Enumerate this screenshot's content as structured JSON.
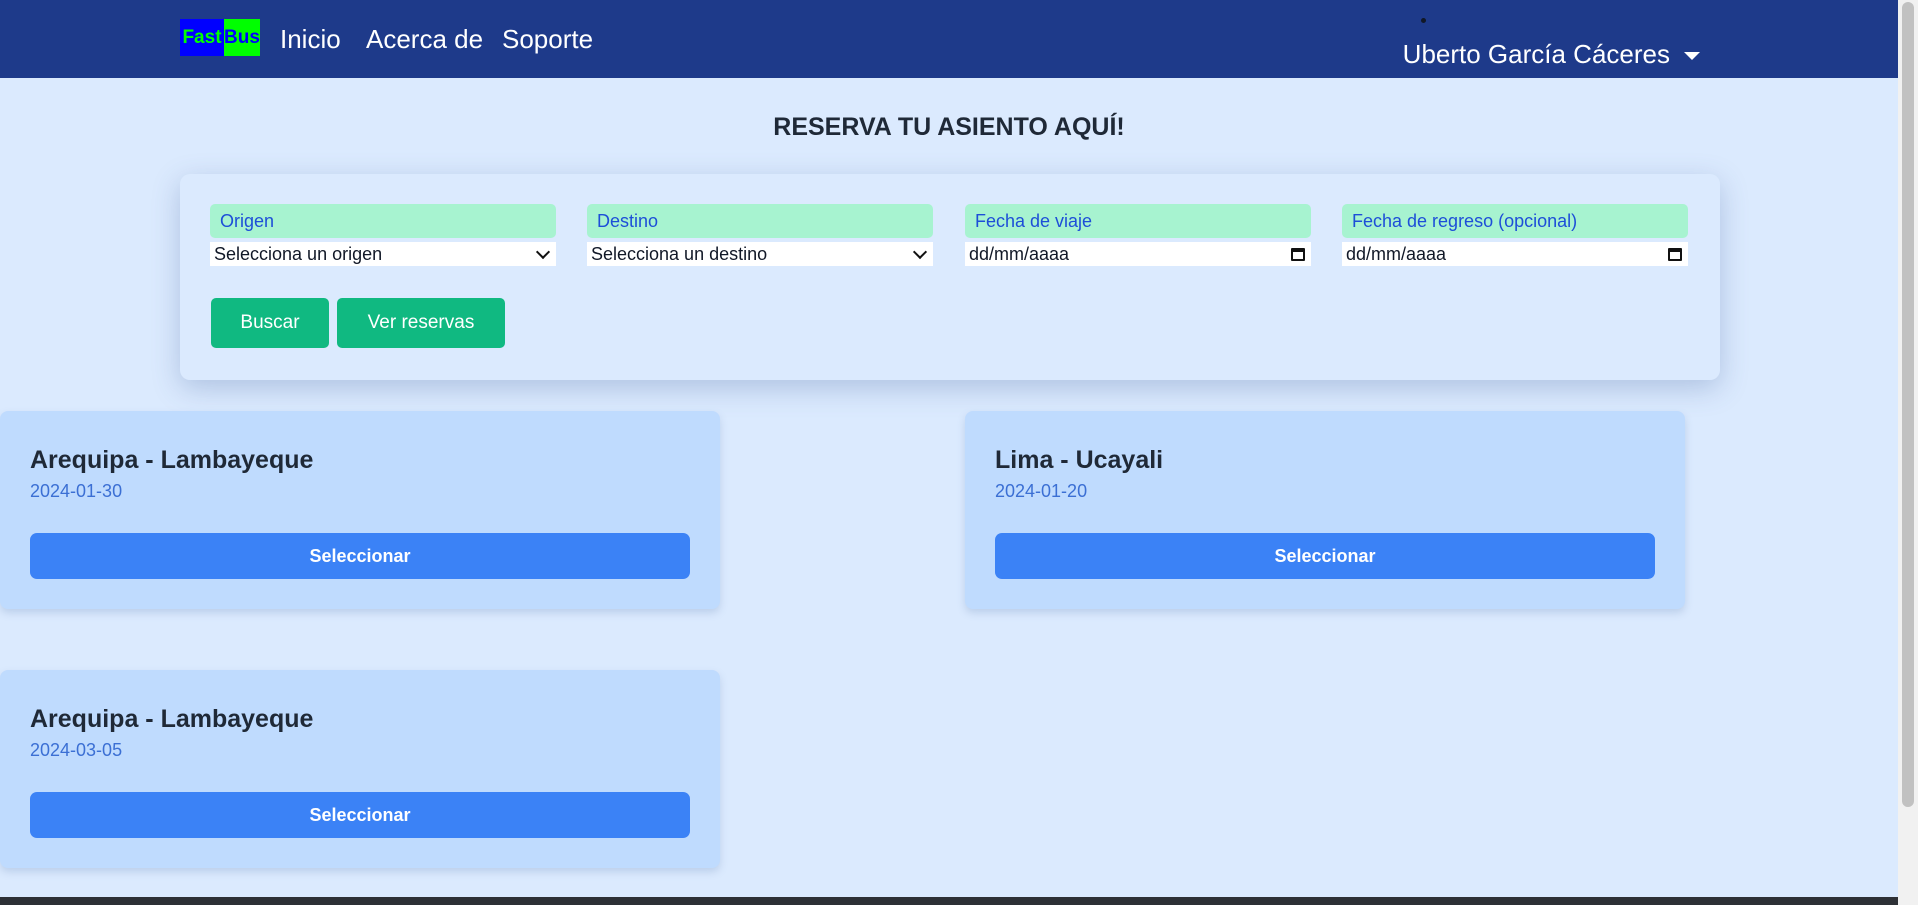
{
  "navbar": {
    "logo_left": "Fast",
    "logo_right": "Bus",
    "links": [
      "Inicio",
      "Acerca de",
      "Soporte"
    ],
    "user_name": "Uberto García Cáceres"
  },
  "page_title": "RESERVA TU ASIENTO AQUÍ!",
  "search": {
    "origin_label": "Origen",
    "origin_value": "Selecciona un origen",
    "destination_label": "Destino",
    "destination_value": "Selecciona un destino",
    "travel_date_label": "Fecha de viaje",
    "travel_date_value": "dd/mm/aaaa",
    "return_date_label": "Fecha de regreso (opcional)",
    "return_date_value": "dd/mm/aaaa",
    "search_button": "Buscar",
    "reservations_button": "Ver reservas"
  },
  "routes": [
    {
      "title": "Arequipa - Lambayeque",
      "date": "2024-01-30",
      "button": "Seleccionar"
    },
    {
      "title": "Lima - Ucayali",
      "date": "2024-01-20",
      "button": "Seleccionar"
    },
    {
      "title": "Arequipa - Lambayeque",
      "date": "2024-03-05",
      "button": "Seleccionar"
    }
  ],
  "colors": {
    "navbar": "#1e3a8a",
    "background": "#dbeafe",
    "label_bg": "#a7f3d0",
    "green_button": "#10b981",
    "card_bg": "#bfdbfe",
    "blue_button": "#3b82f6"
  }
}
